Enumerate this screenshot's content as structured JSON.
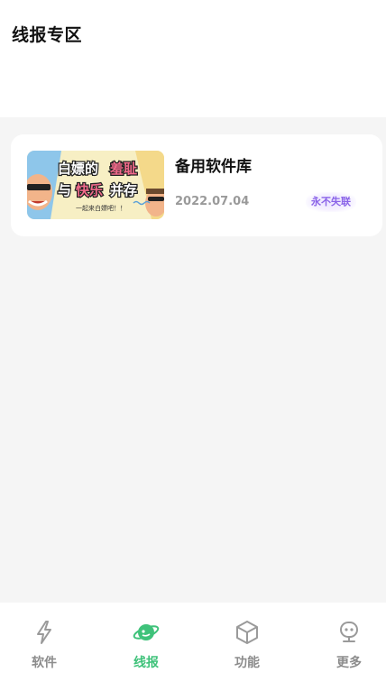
{
  "header": {
    "title": "线报专区"
  },
  "cards": [
    {
      "title": "备用软件库",
      "date": "2022.07.04",
      "tag": "永不失联",
      "thumbnail": {
        "line1": "白嫖的",
        "line1_highlight": "羞耻",
        "line2": "与",
        "line2_highlight": "快乐",
        "line2_tail": "并存",
        "caption": "一起来白嫖吧！！"
      }
    }
  ],
  "tabbar": {
    "items": [
      {
        "label": "软件",
        "icon": "lightning-icon",
        "active": false
      },
      {
        "label": "线报",
        "icon": "planet-icon",
        "active": true
      },
      {
        "label": "功能",
        "icon": "cube-icon",
        "active": false
      },
      {
        "label": "更多",
        "icon": "robot-icon",
        "active": false
      }
    ]
  },
  "colors": {
    "accent": "#3fc27a",
    "inactive": "#8c8c8c",
    "tag": "#8a63e8",
    "background": "#f5f5f5"
  }
}
